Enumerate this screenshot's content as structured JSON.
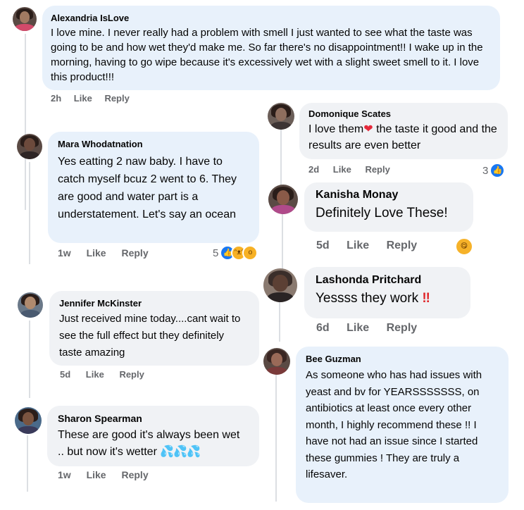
{
  "comments": [
    {
      "author": "Alexandria IsLove",
      "text": "I love mine. I never really had a problem with smell I just wanted to see what the taste was going to be and how wet they'd make me. So far there's no disappointment!! I wake up in the morning, having to go wipe because it's excessively wet with a slight sweet smell to it. I love this product!!!",
      "time": "2h",
      "like": "Like",
      "reply": "Reply"
    },
    {
      "author": "Domonique Scates",
      "text_a": "I love them",
      "heart": "❤",
      "text_b": " the taste it good and the results are even better",
      "time": "2d",
      "like": "Like",
      "reply": "Reply",
      "reaction_count": "3"
    },
    {
      "author": "Mara Whodatnation",
      "text": "Yes eatting 2 naw baby. I have to catch myself bcuz 2 went to 6. They are good and water part is a understatement. Let's say an ocean",
      "time": "1w",
      "like": "Like",
      "reply": "Reply",
      "reaction_count": "5"
    },
    {
      "author": "Kanisha Monay",
      "text": "Definitely Love These!",
      "time": "5d",
      "like": "Like",
      "reply": "Reply"
    },
    {
      "author": "Lashonda Pritchard",
      "text": "Yessss they work ",
      "emoji": "‼",
      "time": "6d",
      "like": "Like",
      "reply": "Reply"
    },
    {
      "author": "Jennifer McKinster",
      "text": "Just received mine today....cant wait to see the full effect but they definitely taste amazing",
      "time": "5d",
      "like": "Like",
      "reply": "Reply"
    },
    {
      "author": "Bee Guzman",
      "text": "As someone who has had issues with yeast and bv for YEARSSSSSSS, on antibiotics at least once every other month, I highly recommend these !! I have not had an issue since I started these gummies ! They are truly a lifesaver.",
      "time": "",
      "like": "",
      "reply": ""
    },
    {
      "author": "Sharon Spearman",
      "text": "These are good it's always been wet .. but now it's wetter ",
      "emoji": "💦💦💦",
      "time": "1w",
      "like": "Like",
      "reply": "Reply"
    }
  ],
  "icons": {
    "like": "like-reaction-icon",
    "haha": "haha-reaction-icon",
    "wow": "wow-reaction-icon",
    "yum": "yum-reaction-icon"
  },
  "colors": {
    "bubble_blue": "#e8f1fb",
    "bubble_gray": "#f0f2f5",
    "meta_gray": "#65676b",
    "like_blue": "#1877f2"
  }
}
